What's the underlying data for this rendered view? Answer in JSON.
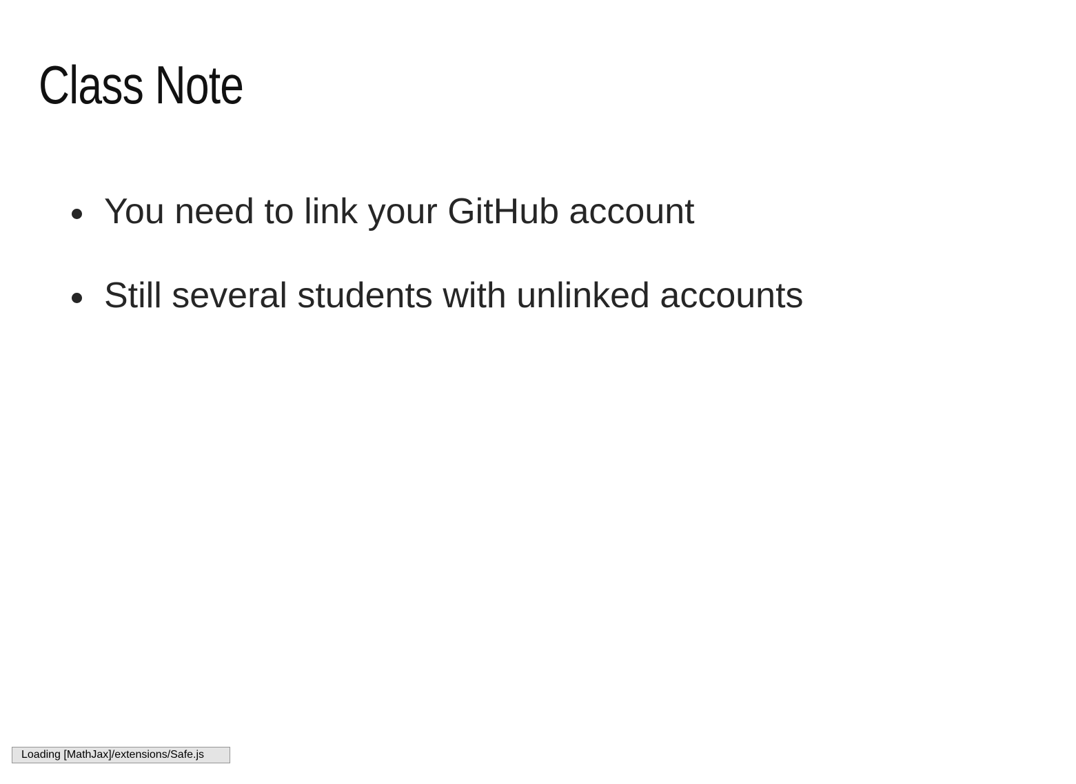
{
  "slide": {
    "title": "Class Note",
    "bullets": [
      "You need to link your GitHub account",
      "Still several students with unlinked accounts"
    ]
  },
  "status": {
    "message": "Loading [MathJax]/extensions/Safe.js"
  },
  "colors": {
    "background": "#ffffff",
    "title_text": "#111111",
    "body_text": "#262626",
    "status_background": "#e4e4e4",
    "status_border": "#959595"
  }
}
